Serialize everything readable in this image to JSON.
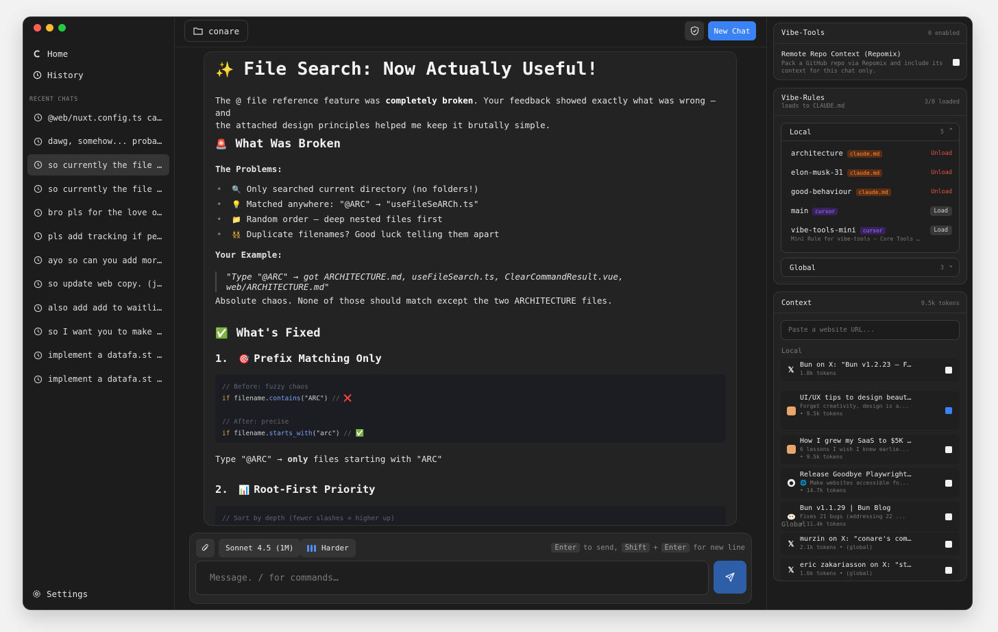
{
  "sidebar": {
    "home_label": "Home",
    "history_label": "History",
    "recent_label": "RECENT CHATS",
    "chats": [
      "@web/nuxt.config.ts ca…",
      "dawg, somehow... proba…",
      "so currently the file …",
      "so currently the file …",
      "bro pls for the love o…",
      "pls add tracking if pe…",
      "ayo so can you add mor…",
      "so update web copy. (j…",
      "also add add to waitli…",
      "so I want you to make …",
      "implement a datafa.st …",
      "implement a datafa.st …"
    ],
    "settings_label": "Settings"
  },
  "topbar": {
    "folder_name": "conare",
    "new_chat_label": "New Chat"
  },
  "message": {
    "title_emoji": "✨",
    "title": "File Search: Now Actually Useful!",
    "intro_1a": "The @ file reference feature was ",
    "intro_1b": "completely broken",
    "intro_1c": ". Your feedback showed exactly what was wrong — and",
    "intro_2": "the attached design principles helped me keep it brutally simple.",
    "broken_emoji": "🚨",
    "broken_heading": "What Was Broken",
    "problems_label": "The Problems:",
    "problems": [
      {
        "emoji": "🔍",
        "text": "Only searched current directory (no folders!)"
      },
      {
        "emoji": "💡",
        "text": "Matched anywhere: \"@ARC\" → \"useFileSeARCh.ts\""
      },
      {
        "emoji": "📁",
        "text": "Random order — deep nested files first"
      },
      {
        "emoji": "👯",
        "text": "Duplicate filenames? Good luck telling them apart"
      }
    ],
    "example_label": "Your Example:",
    "example_quote": "\"Type \"@ARC\" → got ARCHITECTURE.md, useFileSearch.ts, ClearCommandResult.vue, web/ARCHITECTURE.md\"",
    "chaos_text": "Absolute chaos. None of those should match except the two ARCHITECTURE files.",
    "fixed_emoji": "✅",
    "fixed_heading": "What's Fixed",
    "fix1_num": "1.",
    "fix1_emoji": "🎯",
    "fix1_heading": "Prefix Matching Only",
    "code1": {
      "c1": "// Before: fuzzy chaos",
      "kw1": "if",
      "obj1": "filename.",
      "fn1": "contains",
      "args1": "(\"ARC\")",
      "cm1": "//",
      "mark1": "❌",
      "c2": "// After: precise",
      "kw2": "if",
      "obj2": "filename.",
      "fn2": "starts_with",
      "args2": "(\"arc\")",
      "cm2": "//",
      "mark2": "✅"
    },
    "type_line_a": "Type \"@ARC\" → ",
    "type_line_b": "only",
    "type_line_c": " files starting with \"ARC\"",
    "fix2_num": "2.",
    "fix2_emoji": "📊",
    "fix2_heading": "Root-First Priority",
    "code2_comment": "// Sort by depth (fewer slashes = higher up)"
  },
  "composer": {
    "model_label": "Sonnet 4.5 (1M)",
    "effort_label": "Harder",
    "hint_enter": "Enter",
    "hint_to_send": "to send,",
    "hint_shift": "Shift",
    "hint_plus": "+",
    "hint_enter2": "Enter",
    "hint_new_line": "for new line",
    "placeholder": "Message. / for commands…"
  },
  "vibe_tools": {
    "title": "Vibe-Tools",
    "meta": "0 enabled",
    "item_title": "Remote Repo Context (Repomix)",
    "item_desc_1": "Pack a GitHub repo via Repomix and include its",
    "item_desc_2": "context for this chat only.",
    "item_enabled": false
  },
  "vibe_rules": {
    "title": "Vibe-Rules",
    "subtitle": "loads to CLAUDE.md",
    "meta": "3/8 loaded",
    "local_label": "Local",
    "local_count": "5",
    "rules": [
      {
        "name": "architecture",
        "tag": "claude.md",
        "tag_type": "claude",
        "action": "Unload"
      },
      {
        "name": "elon-musk-31",
        "tag": "claude.md",
        "tag_type": "claude",
        "action": "Unload"
      },
      {
        "name": "good-behaviour",
        "tag": "claude.md",
        "tag_type": "claude",
        "action": "Unload"
      },
      {
        "name": "main",
        "tag": "cursor",
        "tag_type": "cursor",
        "action": "Load"
      },
      {
        "name": "vibe-tools-mini",
        "tag": "cursor",
        "tag_type": "cursor",
        "action": "Load",
        "desc": "Mini Rule for vibe-tools – Core Tools …"
      }
    ],
    "global_label": "Global",
    "global_count": "3"
  },
  "context": {
    "title": "Context",
    "meta": "9.5k tokens",
    "url_placeholder": "Paste a website URL...",
    "local_label": "Local",
    "global_label": "Global",
    "local_items": [
      {
        "icon": "x-icon",
        "title": "Bun on X: \"Bun v1.2.23 – F…",
        "sub1": "1.8k tokens",
        "sub2": "",
        "checked": false
      },
      {
        "icon": "avatar-icon",
        "title": "UI/UX tips to design beaut…",
        "sub1": "Forget creativity, design is a...",
        "sub2": "•  9.5k tokens",
        "checked": true
      },
      {
        "icon": "avatar-icon",
        "title": "How I grew my SaaS to $5K …",
        "sub1": "6 lessons I wish I knew earlie...",
        "sub2": "•  9.5k tokens",
        "checked": false
      },
      {
        "icon": "github-icon",
        "title": "Release Goodbye Playwright…",
        "sub1": "🌐 Make websites accessible fo...",
        "sub2": "•  14.7k tokens",
        "checked": false
      },
      {
        "icon": "bun-icon",
        "title": "Bun v1.1.29 | Bun Blog",
        "sub1": "Fixes 21 bugs (addressing 22  ...",
        "sub2": "•  11.4k tokens",
        "checked": false
      }
    ],
    "global_items": [
      {
        "icon": "x-icon",
        "title": "murzin on X: \"conare's com…",
        "sub1": "2.1k tokens  • (global)",
        "checked": false
      },
      {
        "icon": "x-icon",
        "title": "eric zakariasson on X: \"st…",
        "sub1": "1.6k tokens  • (global)",
        "checked": false
      }
    ]
  },
  "colors": {
    "accent": "#3b82f6",
    "claude_tag": "#ff8a3d",
    "cursor_tag": "#a67cf0",
    "unload": "#e5533d"
  }
}
